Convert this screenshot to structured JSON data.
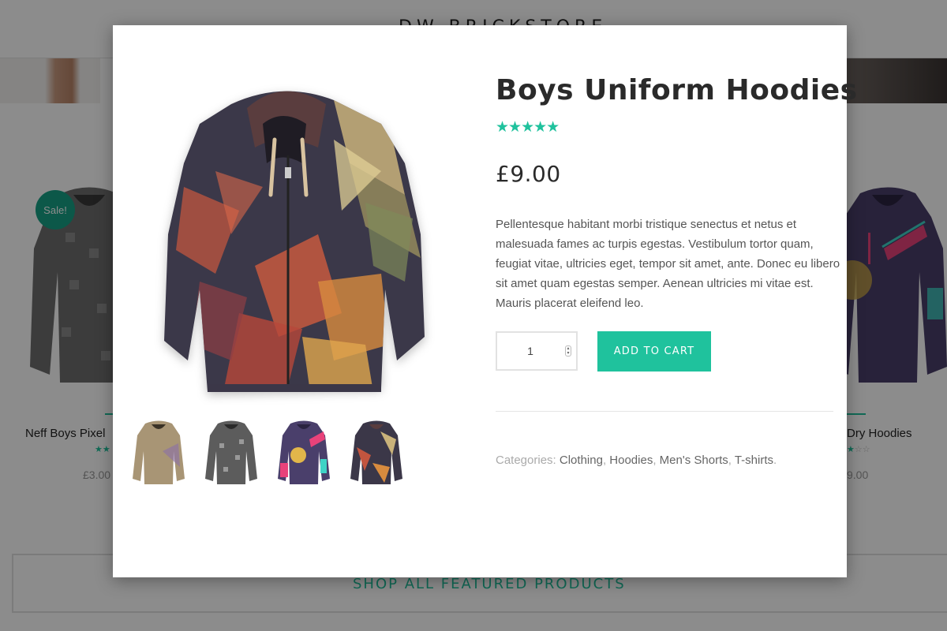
{
  "background": {
    "logo": "DW BRICKSTORE",
    "products": [
      {
        "title": "Neff Boys Pixel",
        "stars": "★★",
        "price": "£3.00",
        "badge": "Sale!"
      },
      {
        "title": "Dry Hoodies",
        "stars_on": "★",
        "stars_off": "☆☆",
        "price": "9.00"
      }
    ],
    "shop_all": "SHOP ALL FEATURED PRODUCTS"
  },
  "modal": {
    "title": "Boys Uniform Hoodies",
    "rating": {
      "value": 5,
      "max": 5,
      "glyphs": "★★★★★"
    },
    "price": "£9.00",
    "description": "Pellentesque habitant morbi tristique senectus et netus et malesuada fames ac turpis egestas. Vestibulum tortor quam, feugiat vitae, ultricies eget, tempor sit amet, ante. Donec eu libero sit amet quam egestas semper. Aenean ultricies mi vitae est. Mauris placerat eleifend leo.",
    "quantity": "1",
    "add_to_cart": "ADD TO CART",
    "categories_label": "Categories:",
    "categories": [
      "Clothing",
      "Hoodies",
      "Men's Shorts",
      "T-shirts"
    ],
    "thumbnails": [
      "tan-hoodie",
      "grey-pattern-hoodie",
      "purple-pattern-hoodie",
      "geometric-hoodie"
    ]
  },
  "colors": {
    "accent": "#1fc29d",
    "sale_badge": "#16a085",
    "overlay": "rgba(0,0,0,0.45)",
    "text_dark": "#2a2a2a"
  }
}
